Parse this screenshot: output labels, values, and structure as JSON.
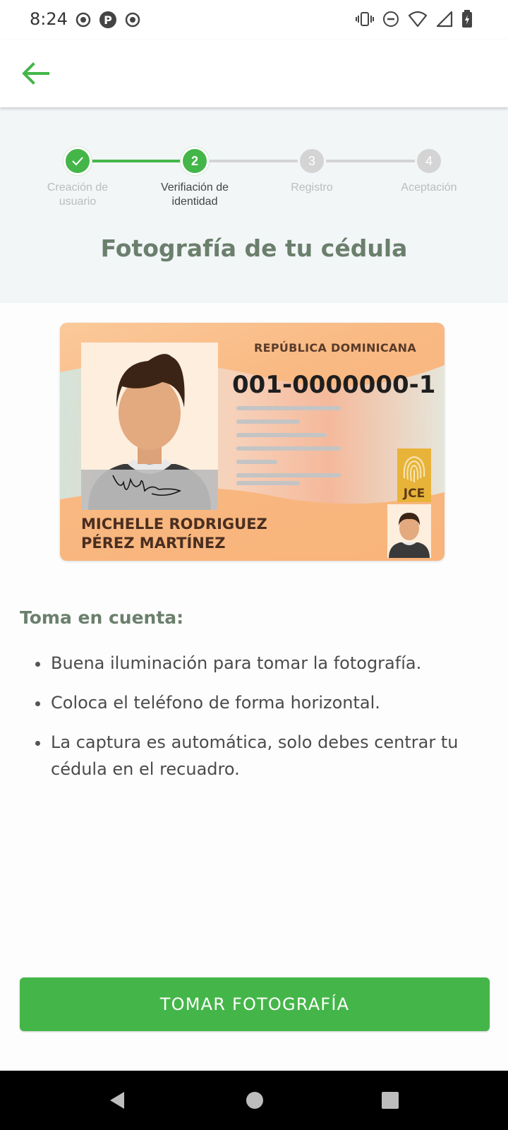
{
  "status_bar": {
    "time": "8:24",
    "left_icons": [
      "record-icon",
      "app-p-icon",
      "record-icon"
    ],
    "right_icons": [
      "vibrate-icon",
      "dnd-icon",
      "wifi-icon",
      "signal-icon",
      "battery-charging-icon"
    ]
  },
  "app_bar": {
    "back_icon": "arrow-left-icon"
  },
  "stepper": {
    "steps": [
      {
        "number": "✓",
        "label_line1": "Creación de",
        "label_line2": "usuario",
        "state": "done"
      },
      {
        "number": "2",
        "label_line1": "Verifiación de",
        "label_line2": "identidad",
        "state": "active"
      },
      {
        "number": "3",
        "label_line1": "Registro",
        "label_line2": "",
        "state": "pending"
      },
      {
        "number": "4",
        "label_line1": "Aceptación",
        "label_line2": "",
        "state": "pending"
      }
    ]
  },
  "screen_title": "Fotografía de tu cédula",
  "card": {
    "country": "REPÚBLICA DOMINICANA",
    "number": "001-0000000-1",
    "name_line1": "MICHELLE RODRIGUEZ",
    "name_line2": "PÉREZ MARTÍNEZ",
    "emblem": "JCE"
  },
  "info": {
    "title": "Toma en cuenta:",
    "bullets": [
      "Buena iluminación para tomar la fotografía.",
      "Coloca el teléfono de forma horizontal.",
      "La captura es automática, solo debes centrar tu cédula en el recuadro."
    ]
  },
  "primary_button": {
    "label": "TOMAR FOTOGRAFÍA"
  },
  "colors": {
    "accent": "#44b649",
    "title": "#6b7f6d",
    "step_pending": "#d4d4d4"
  },
  "nav": [
    "back-icon",
    "home-icon",
    "recents-icon"
  ]
}
